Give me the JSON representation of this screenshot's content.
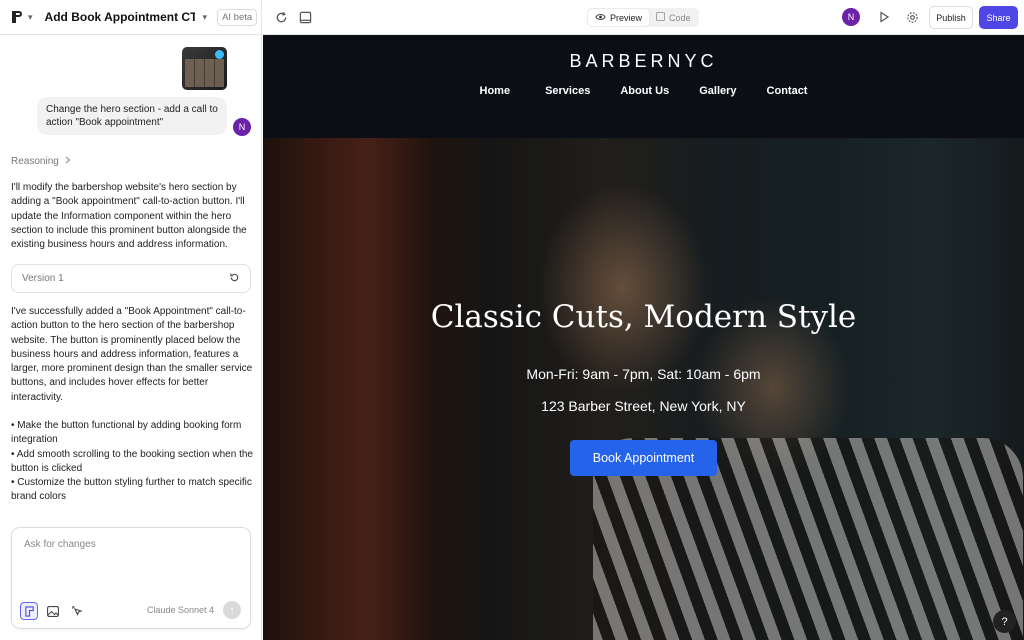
{
  "topbar": {
    "project_title": "Add Book Appointment CTA to H...",
    "ai_badge": "AI beta",
    "preview_label": "Preview",
    "code_label": "Code",
    "avatar_initial": "N",
    "publish_label": "Publish",
    "share_label": "Share",
    "accent": "#4f46e5"
  },
  "chat": {
    "user_message": "Change the hero section - add a call to action \"Book appointment\"",
    "user_initial": "N",
    "reasoning_label": "Reasoning",
    "intro": "I'll modify the barbershop website's hero section by adding a \"Book appointment\" call-to-action button. I'll update the Information component within the hero section to include this prominent button alongside the existing business hours and address information.",
    "version_label": "Version 1",
    "summary": "I've successfully added a \"Book Appointment\" call-to-action button to the hero section of the barbershop website. The button is prominently placed below the business hours and address information, features a larger, more prominent design than the smaller service buttons, and includes hover effects for better interactivity.",
    "bullets": "• Make the button functional by adding booking form integration\n• Add smooth scrolling to the booking section when the button is clicked\n• Customize the button styling further to match specific brand colors",
    "input_placeholder": "Ask for changes",
    "model_label": "Claude Sonnet 4"
  },
  "site": {
    "brand": "BARBERNYC",
    "nav": [
      "Home",
      "Services",
      "About Us",
      "Gallery",
      "Contact"
    ],
    "hero_title": "Classic Cuts, Modern Style",
    "hours": "Mon-Fri: 9am - 7pm, Sat: 10am - 6pm",
    "address": "123 Barber Street, New York, NY",
    "cta_label": "Book Appointment",
    "cta_color": "#2563eb"
  },
  "help_label": "?"
}
